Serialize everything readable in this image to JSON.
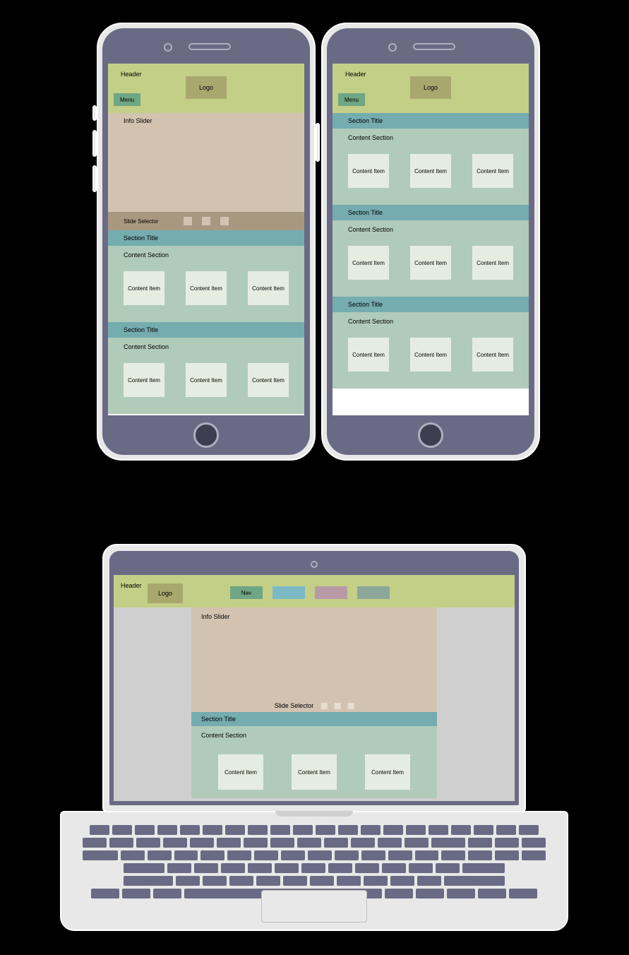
{
  "colors": {
    "header_bg": "#C3CF87",
    "logo_bg": "#A8A86E",
    "menu_bg": "#6FA684",
    "infoslider_bg": "#D2C3B0",
    "slidesel_bg": "#A99880",
    "section_title_bg": "#74ACB0",
    "content_section_bg": "#B0CBB9",
    "content_item_bg": "#E5EDE1",
    "nav_colors": [
      "#6FA684",
      "#7CB9C4",
      "#B89AA6",
      "#8CA79A"
    ]
  },
  "labels": {
    "header": "Header",
    "logo": "Logo",
    "menu": "Menu",
    "info_slider": "Info Slider",
    "slide_selector": "Slide Selector",
    "section_title": "Section Title",
    "content_section": "Content Section",
    "content_item": "Content Item",
    "nav": "Nav"
  },
  "phone_left": {
    "blocks": [
      {
        "type": "header",
        "show_menu": true
      },
      {
        "type": "infoslider"
      },
      {
        "type": "slidesel",
        "dots": 3
      },
      {
        "type": "section_title"
      },
      {
        "type": "content_section",
        "items": 3
      },
      {
        "type": "section_title"
      },
      {
        "type": "content_section",
        "items": 3
      }
    ]
  },
  "phone_right": {
    "blocks": [
      {
        "type": "header",
        "show_menu": true
      },
      {
        "type": "section_title"
      },
      {
        "type": "content_section",
        "items": 3
      },
      {
        "type": "section_title"
      },
      {
        "type": "content_section",
        "items": 3
      },
      {
        "type": "section_title"
      },
      {
        "type": "content_section",
        "items": 3
      }
    ]
  },
  "laptop": {
    "nav_items": 4,
    "blocks": [
      {
        "type": "infoslider",
        "slidesel_dots": 3
      },
      {
        "type": "section_title"
      },
      {
        "type": "content_section",
        "items": 3
      }
    ]
  }
}
